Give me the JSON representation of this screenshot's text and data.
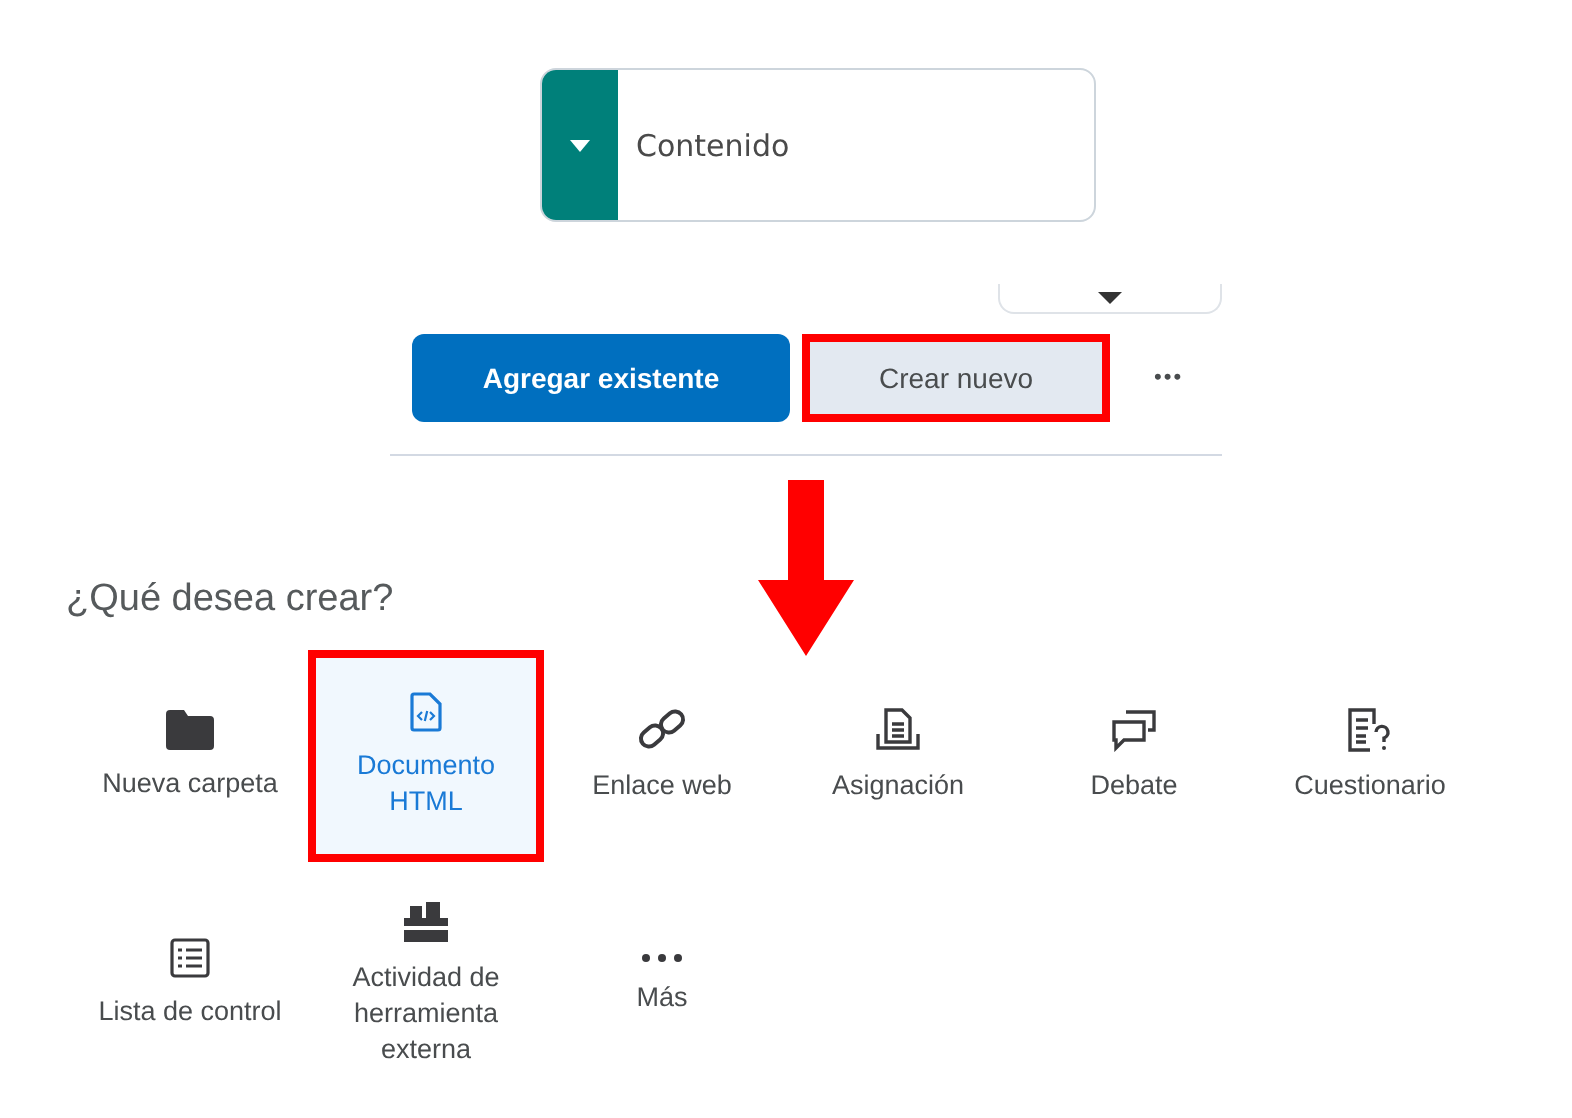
{
  "dropdown": {
    "label": "Contenido"
  },
  "buttons": [
    {
      "label": "Agregar existente",
      "kind": "primary",
      "highlighted": false
    },
    {
      "label": "Crear nuevo",
      "kind": "secondary",
      "highlighted": true
    }
  ],
  "more_button": {
    "label": "•••"
  },
  "heading": "¿Qué desea crear?",
  "items": [
    {
      "label": "Nueva carpeta",
      "kind": "folder",
      "selected": false,
      "highlighted": false
    },
    {
      "label": "Documento HTML",
      "kind": "html",
      "selected": true,
      "highlighted": true
    },
    {
      "label": "Enlace web",
      "kind": "link",
      "selected": false,
      "highlighted": false
    },
    {
      "label": "Asignación",
      "kind": "assignment",
      "selected": false,
      "highlighted": false
    },
    {
      "label": "Debate",
      "kind": "chat",
      "selected": false,
      "highlighted": false
    },
    {
      "label": "Cuestionario",
      "kind": "quiz",
      "selected": false,
      "highlighted": false
    },
    {
      "label": "Lista de control",
      "kind": "checklist",
      "selected": false,
      "highlighted": false
    },
    {
      "label": "Actividad de herramienta externa",
      "kind": "blocks",
      "selected": false,
      "highlighted": false
    },
    {
      "label": "Más",
      "kind": "more",
      "selected": false,
      "highlighted": false
    }
  ]
}
